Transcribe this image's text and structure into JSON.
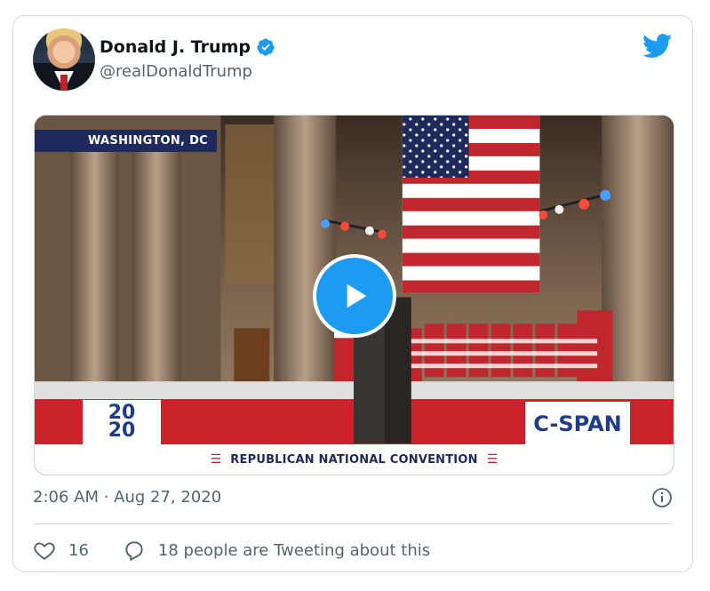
{
  "author": {
    "name": "Donald J. Trump",
    "handle": "@realDonaldTrump",
    "verified": true
  },
  "media": {
    "location_tag": "WASHINGTON, DC",
    "logo_2020_top": "20",
    "logo_2020_bottom": "20",
    "network_logo": "C-SPAN",
    "banner_text": "REPUBLICAN NATIONAL CONVENTION",
    "play_icon": "play-icon"
  },
  "timestamp": "2:06 AM · Aug 27, 2020",
  "actions": {
    "like_count": "16",
    "reply_text": "18 people are Tweeting about this"
  },
  "colors": {
    "twitter_blue": "#1d9bf0",
    "text_secondary": "#536471",
    "border": "#cfd9de",
    "rnc_navy": "#1f2a5c",
    "rnc_red": "#c0272d"
  }
}
